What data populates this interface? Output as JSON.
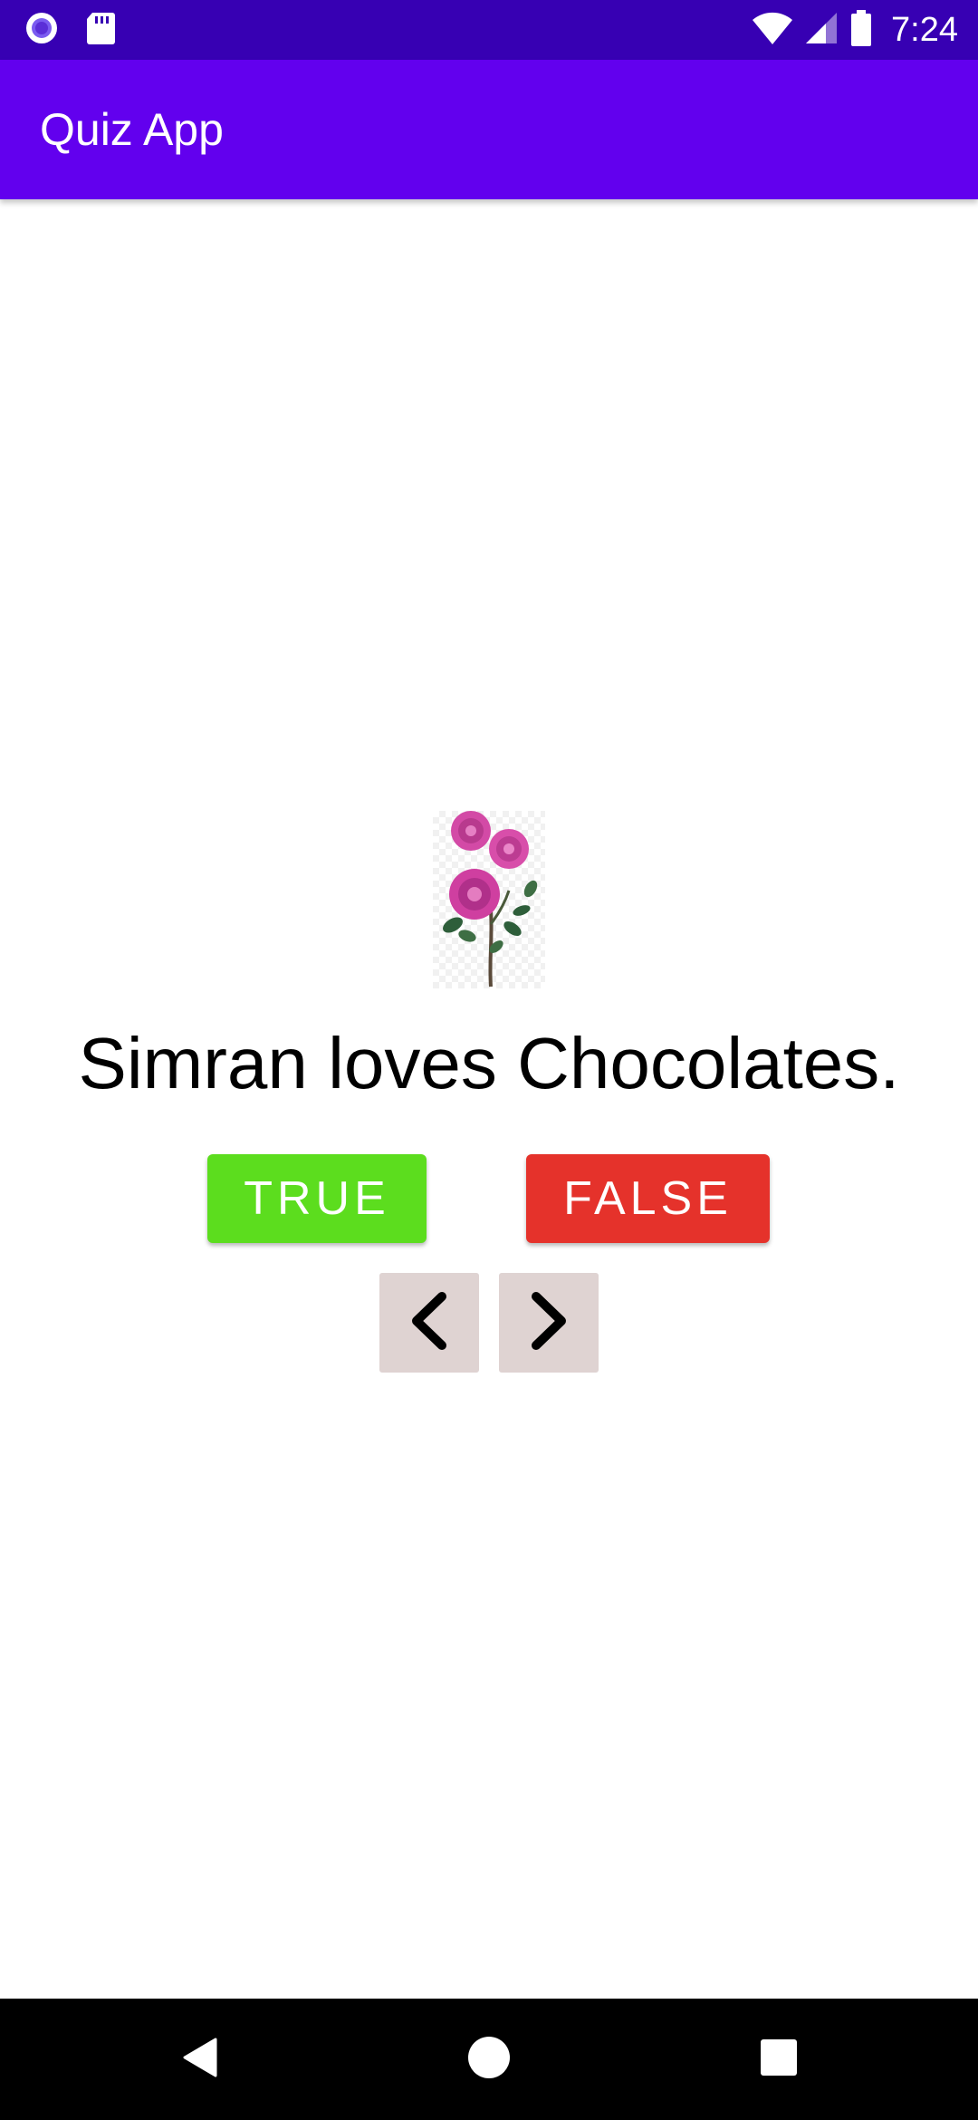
{
  "status_bar": {
    "time": "7:24",
    "left_icons": [
      "notification-dot-icon",
      "sd-card-icon"
    ],
    "right_icons": [
      "wifi-icon",
      "cell-signal-icon",
      "battery-icon"
    ],
    "color": "#3700b3"
  },
  "app_bar": {
    "title": "Quiz App",
    "color": "#6200ee"
  },
  "quiz": {
    "image_icon": "rose-flower-image",
    "question": "Simran loves Chocolates.",
    "true_label": "TRUE",
    "false_label": "FALSE",
    "true_color": "#5cdd1e",
    "false_color": "#e5322b",
    "prev_icon": "chevron-left-icon",
    "next_icon": "chevron-right-icon"
  },
  "nav_bar": {
    "icons": [
      "back-icon",
      "home-icon",
      "recents-icon"
    ]
  }
}
